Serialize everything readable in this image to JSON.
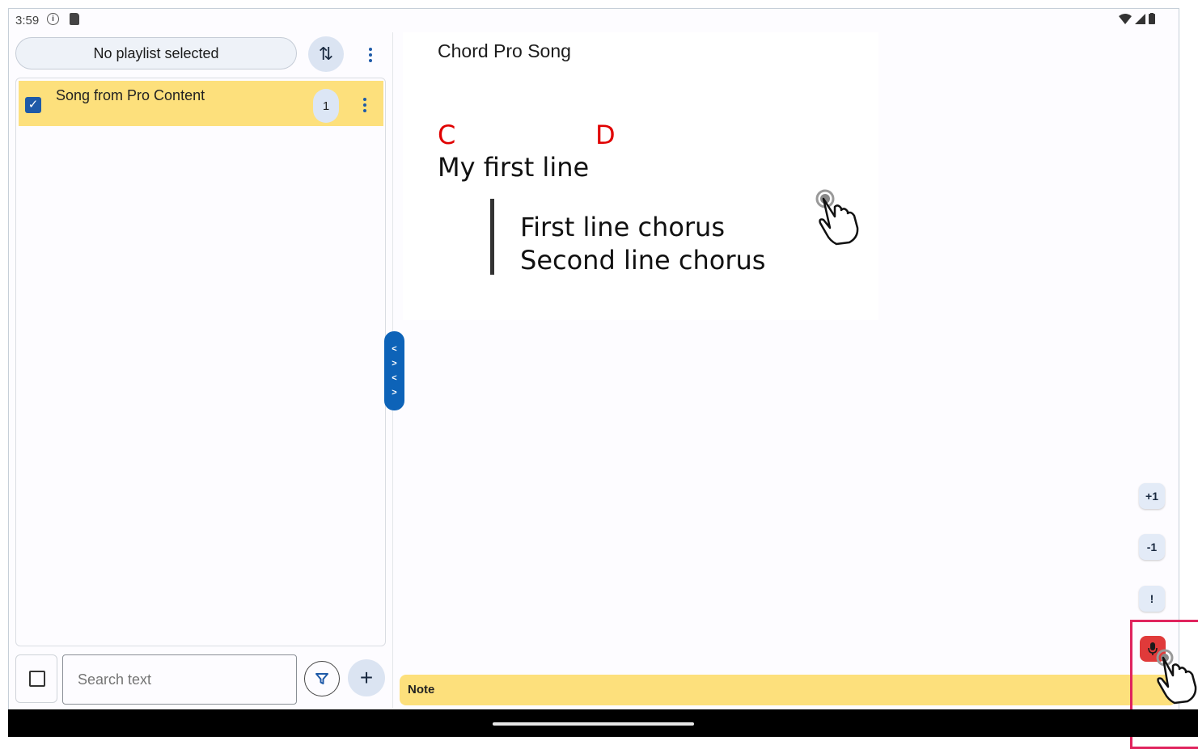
{
  "status": {
    "time": "3:59",
    "info_glyph": "i"
  },
  "left": {
    "playlist_label": "No playlist selected",
    "sort_glyph": "⇅",
    "songs": [
      {
        "title": "Song from Pro Content",
        "count": "1",
        "checked": true
      }
    ],
    "search_placeholder": "Search text",
    "add_glyph": "+"
  },
  "divider_glyphs": [
    "<",
    ">",
    "<",
    ">"
  ],
  "song": {
    "title": "Chord Pro Song",
    "chords": [
      "C",
      "D"
    ],
    "first_line": "My first line",
    "chorus": [
      "First line chorus",
      "Second line chorus"
    ]
  },
  "controls": {
    "plus_one": "+1",
    "minus_one": "-1",
    "alert": "!"
  },
  "note_label": "Note",
  "colors": {
    "accent": "#1e5aa8",
    "highlight_row": "#fde07c",
    "chord": "#e00000",
    "mic": "#e03a3a",
    "marker": "#e0245e"
  },
  "icons": [
    "info-icon",
    "sd-card-icon",
    "wifi-icon",
    "signal-icon",
    "battery-icon",
    "sort-icon",
    "more-vert-icon",
    "check-icon",
    "filter-icon",
    "add-icon",
    "mic-icon",
    "tap-hand-icon"
  ]
}
